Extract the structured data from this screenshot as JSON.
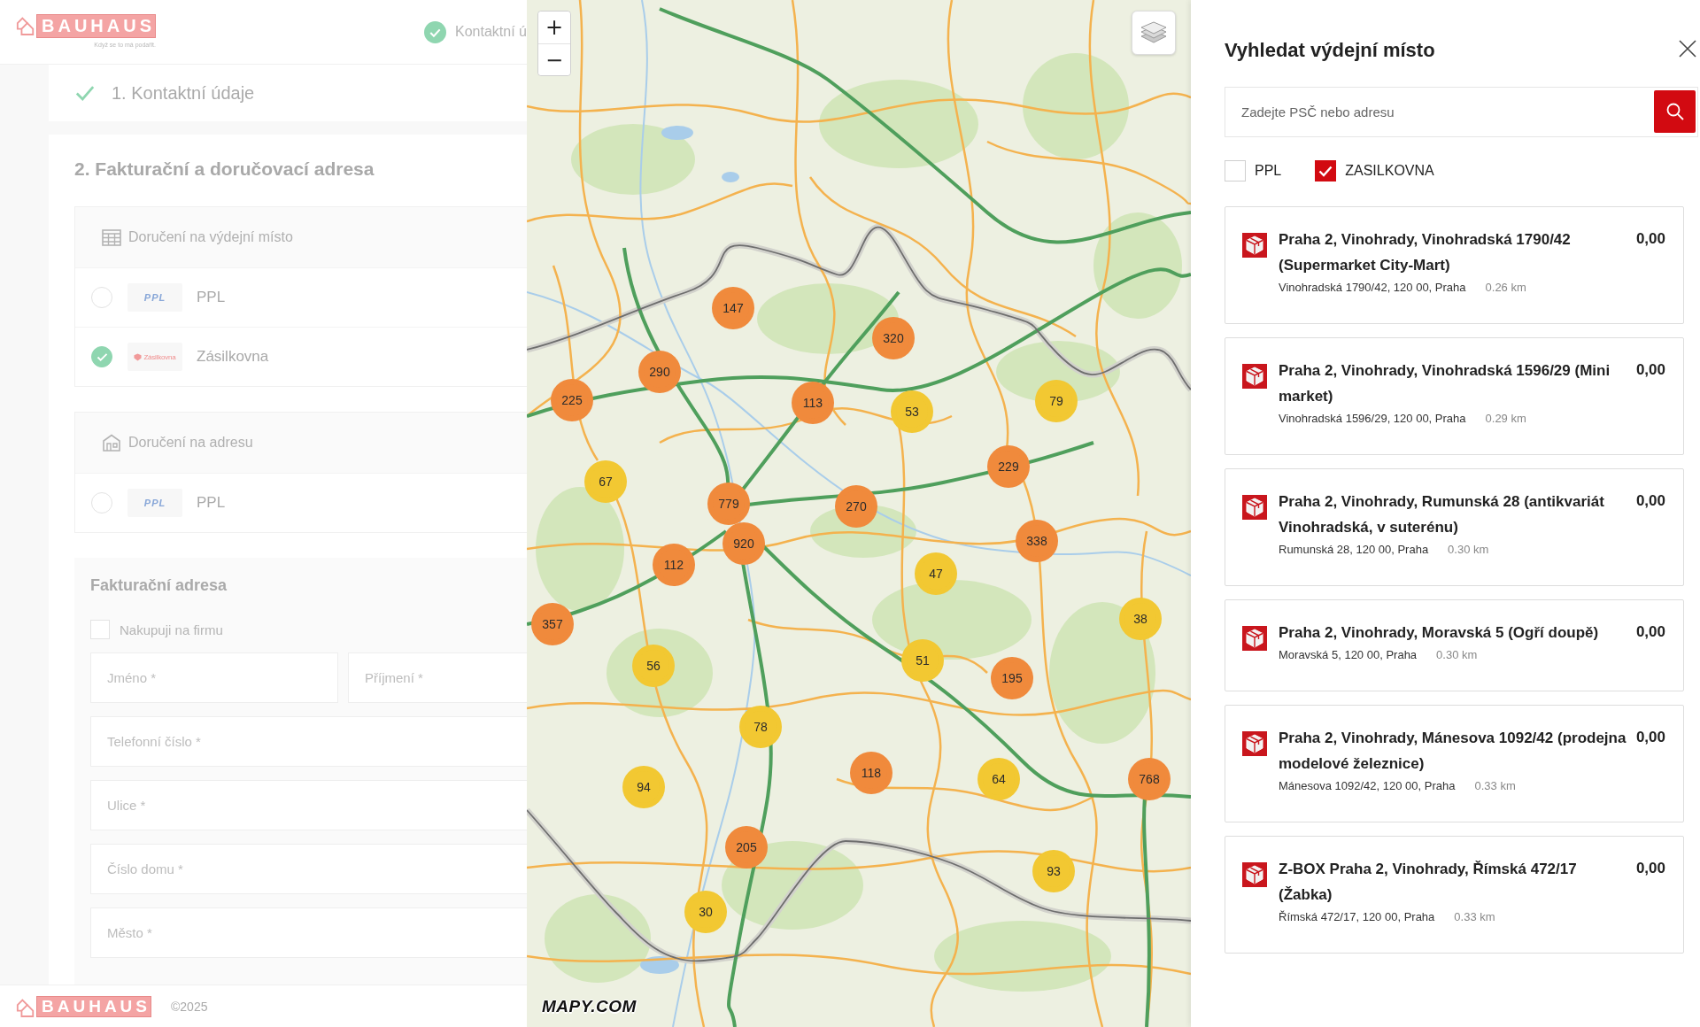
{
  "header": {
    "logo": {
      "text": "BAUHAUS",
      "tagline": "Když se to má podařit."
    },
    "steps": [
      {
        "label": "Kontaktní ú",
        "done": true
      }
    ]
  },
  "contact_section": {
    "title": "1. Kontaktní údaje",
    "done": true
  },
  "address_section": {
    "title": "2. Fakturační a doručovací adresa",
    "delivery_groups": [
      {
        "kind": "pickup",
        "title": "Doručení na výdejní místo",
        "options": [
          {
            "kind": "ppl",
            "logo_text": "PPL",
            "label": "PPL",
            "selected": false
          },
          {
            "kind": "zasilkovna",
            "logo_text": "Zásilkovna",
            "label": "Zásilkovna",
            "selected": true
          }
        ]
      },
      {
        "kind": "address",
        "title": "Doručení na adresu",
        "options": [
          {
            "kind": "ppl",
            "logo_text": "PPL",
            "label": "PPL",
            "selected": false
          }
        ]
      }
    ],
    "billing": {
      "title": "Fakturační adresa",
      "company_checkbox": {
        "label": "Nakupuji na firmu",
        "checked": false
      },
      "field_rows": [
        [
          {
            "placeholder": "Jméno *"
          },
          {
            "placeholder": "Příjmení *"
          }
        ],
        [
          {
            "placeholder": "Telefonní číslo *"
          }
        ],
        [
          {
            "placeholder": "Ulice *"
          }
        ],
        [
          {
            "placeholder": "Číslo domu *"
          }
        ],
        [
          {
            "placeholder": "Město *"
          }
        ]
      ]
    }
  },
  "footer": {
    "logo": "BAUHAUS",
    "copyright": "©2025"
  },
  "map": {
    "zoom_in": "+",
    "zoom_out": "−",
    "provider_logo": "MAPY.COM",
    "clusters": [
      {
        "count": "147",
        "color": "#f08a3c"
      },
      {
        "count": "320",
        "color": "#f08a3c"
      },
      {
        "count": "290",
        "color": "#f08a3c"
      },
      {
        "count": "225",
        "color": "#f08a3c"
      },
      {
        "count": "113",
        "color": "#f08a3c"
      },
      {
        "count": "53",
        "color": "#f2c832"
      },
      {
        "count": "79",
        "color": "#f2c832"
      },
      {
        "count": "229",
        "color": "#f08a3c"
      },
      {
        "count": "67",
        "color": "#f2c832"
      },
      {
        "count": "779",
        "color": "#f08a3c"
      },
      {
        "count": "270",
        "color": "#f08a3c"
      },
      {
        "count": "920",
        "color": "#f08a3c"
      },
      {
        "count": "338",
        "color": "#f08a3c"
      },
      {
        "count": "112",
        "color": "#f08a3c"
      },
      {
        "count": "47",
        "color": "#f2c832"
      },
      {
        "count": "357",
        "color": "#f08a3c"
      },
      {
        "count": "38",
        "color": "#f2c832"
      },
      {
        "count": "56",
        "color": "#f2c832"
      },
      {
        "count": "51",
        "color": "#f2c832"
      },
      {
        "count": "195",
        "color": "#f08a3c"
      },
      {
        "count": "78",
        "color": "#f2c832"
      },
      {
        "count": "118",
        "color": "#f08a3c"
      },
      {
        "count": "94",
        "color": "#f2c832"
      },
      {
        "count": "64",
        "color": "#f2c832"
      },
      {
        "count": "768",
        "color": "#f08a3c"
      },
      {
        "count": "205",
        "color": "#f08a3c"
      },
      {
        "count": "93",
        "color": "#f2c832"
      },
      {
        "count": "30",
        "color": "#f2c832"
      }
    ]
  },
  "pickup_panel": {
    "title": "Vyhledat výdejní místo",
    "search": {
      "placeholder": "Zadejte PSČ nebo adresu"
    },
    "filters": [
      {
        "label": "PPL",
        "checked": false
      },
      {
        "label": "ZASILKOVNA",
        "checked": true
      }
    ],
    "results": [
      {
        "name": "Praha 2, Vinohrady, Vinohradská 1790/42 (Supermarket City-Mart)",
        "address": "Vinohradská 1790/42, 120 00, Praha",
        "distance": "0.26 km",
        "price": "0,00"
      },
      {
        "name": "Praha 2, Vinohrady, Vinohradská 1596/29 (Mini market)",
        "address": "Vinohradská 1596/29, 120 00, Praha",
        "distance": "0.29 km",
        "price": "0,00"
      },
      {
        "name": "Praha 2, Vinohrady, Rumunská 28 (antikvariát Vinohradská, v suterénu)",
        "address": "Rumunská 28, 120 00, Praha",
        "distance": "0.30 km",
        "price": "0,00"
      },
      {
        "name": "Praha 2, Vinohrady, Moravská 5 (Ogří doupě)",
        "address": "Moravská 5, 120 00, Praha",
        "distance": "0.30 km",
        "price": "0,00"
      },
      {
        "name": "Praha 2, Vinohrady, Mánesova 1092/42 (prodejna modelové železnice)",
        "address": "Mánesova 1092/42, 120 00, Praha",
        "distance": "0.33 km",
        "price": "0,00"
      },
      {
        "name": "Z-BOX Praha 2, Vinohrady, Římská 472/17 (Žabka)",
        "address": "Římská 472/17, 120 00, Praha",
        "distance": "0.33 km",
        "price": "0,00"
      }
    ]
  }
}
